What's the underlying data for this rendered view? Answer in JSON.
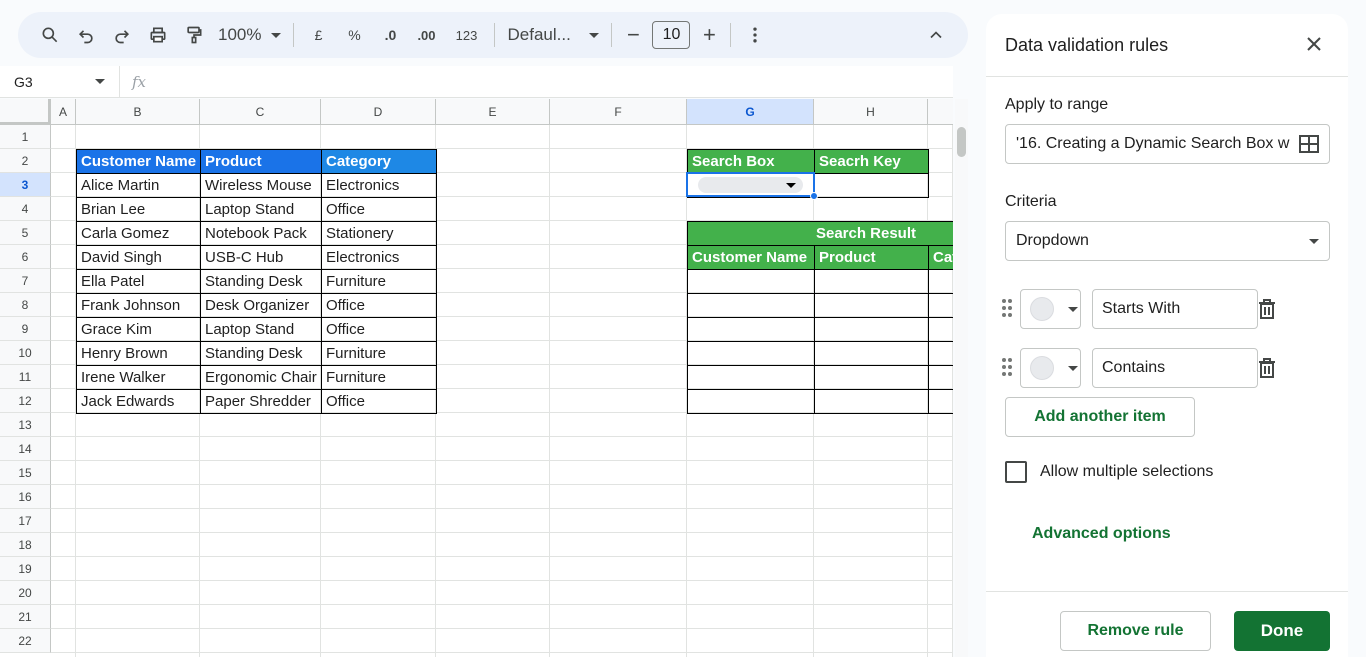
{
  "toolbar": {
    "zoom": "100%",
    "currency": "£",
    "percent": "%",
    "decrease_decimal": ".0",
    "increase_decimal": ".00",
    "number_format": "123",
    "font": "Defaul...",
    "font_size": "10"
  },
  "formula_bar": {
    "cell_ref": "G3",
    "fx": "fx"
  },
  "columns": [
    "A",
    "B",
    "C",
    "D",
    "E",
    "F",
    "G",
    "H"
  ],
  "selected_column": "G",
  "selected_row": "3",
  "rows": [
    "1",
    "2",
    "3",
    "4",
    "5",
    "6",
    "7",
    "8",
    "9",
    "10",
    "11",
    "12",
    "13",
    "14",
    "15",
    "16",
    "17",
    "18",
    "19",
    "20",
    "21",
    "22"
  ],
  "table": {
    "headers": [
      "Customer Name",
      "Product",
      "Category"
    ],
    "rows": [
      [
        "Alice Martin",
        "Wireless Mouse",
        "Electronics"
      ],
      [
        "Brian Lee",
        "Laptop Stand",
        "Office"
      ],
      [
        "Carla Gomez",
        "Notebook Pack",
        "Stationery"
      ],
      [
        "David Singh",
        "USB-C Hub",
        "Electronics"
      ],
      [
        "Ella Patel",
        "Standing Desk",
        "Furniture"
      ],
      [
        "Frank Johnson",
        "Desk Organizer",
        "Office"
      ],
      [
        "Grace Kim",
        "Laptop Stand",
        "Office"
      ],
      [
        "Henry Brown",
        "Standing Desk",
        "Furniture"
      ],
      [
        "Irene Walker",
        "Ergonomic Chair",
        "Furniture"
      ],
      [
        "Jack Edwards",
        "Paper Shredder",
        "Office"
      ]
    ]
  },
  "search": {
    "search_box_label": "Search Box",
    "search_key_label": "Seacrh Key",
    "result_title": "Search Result",
    "result_headers": [
      "Customer Name",
      "Product",
      "Cat"
    ]
  },
  "panel": {
    "title": "Data validation rules",
    "apply_label": "Apply to range",
    "range_value": "'16. Creating a Dynamic Search Box w",
    "criteria_label": "Criteria",
    "criteria_value": "Dropdown",
    "items": [
      "Starts With",
      "Contains"
    ],
    "add_item": "Add another item",
    "allow_multiple": "Allow multiple selections",
    "advanced": "Advanced options",
    "remove_rule": "Remove rule",
    "done": "Done"
  },
  "colors": {
    "header_blue": "#1a73e8",
    "header_green": "#43b14b",
    "accent_green": "#137333"
  }
}
